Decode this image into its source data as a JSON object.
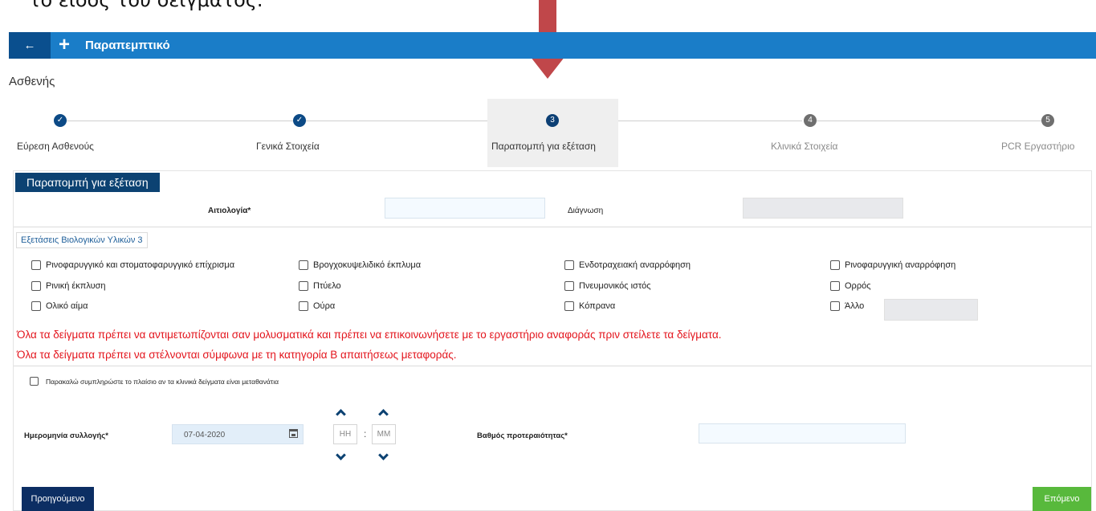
{
  "caption": "το είδος του δείγματος.",
  "header": {
    "back_label": "←",
    "title": "Παραπεμπτικό"
  },
  "page_title": "Ασθενής",
  "steps": [
    {
      "number": "✓",
      "label": "Εύρεση Ασθενούς",
      "state": "done"
    },
    {
      "number": "✓",
      "label": "Γενικά Στοιχεία",
      "state": "done"
    },
    {
      "number": "3",
      "label": "Παραπομπή για εξέταση",
      "state": "current"
    },
    {
      "number": "4",
      "label": "Κλινικά Στοιχεία",
      "state": "todo"
    },
    {
      "number": "5",
      "label": "PCR Εργαστήριο",
      "state": "todo"
    }
  ],
  "form": {
    "section_title": "Παραπομπή για εξέταση",
    "reason_label": "Αιτιολογία*",
    "reason_value": "",
    "diagnosis_label": "Διάγνωση",
    "diagnosis_value": "",
    "samples_tab": "Εξετάσεις Βιολογικών Υλικών 3",
    "samples": [
      "Ρινοφαρυγγικό και στοματοφαρυγγικό επίχρισμα",
      "Βρογχοκυψελιδικό έκπλυμα",
      "Ενδοτραχειακή αναρρόφηση",
      "Ρινοφαρυγγική αναρρόφηση",
      "Ρινική έκπλυση",
      "Πτύελο",
      "Πνευμονικός ιστός",
      "Ορρός",
      "Ολικό αίμα",
      "Ούρα",
      "Κόπρανα",
      "Άλλο"
    ],
    "other_value": "",
    "warning_1": "Όλα τα δείγματα πρέπει να αντιμετωπίζονται σαν μολυσματικά και πρέπει να επικοινωνήσετε με το εργαστήριο αναφοράς πριν στείλετε τα δείγματα.",
    "warning_2": "Όλα τα δείγματα πρέπει να στέλνονται σύμφωνα με τη κατηγορία Β απαιτήσεως μεταφοράς.",
    "transient_label": "Παρακαλώ συμπληρώστε το πλαίσιο αν τα κλινικά δείγματα είναι μεταθανάτια",
    "collection_date_label": "Ημερομηνία συλλογής*",
    "collection_date_value": "07-04-2020",
    "hour_placeholder": "HH",
    "minute_placeholder": "MM",
    "time_separator": ":",
    "priority_label": "Βαθμός προτεραιότητας*",
    "priority_value": ""
  },
  "nav": {
    "prev_label": "Προηγούμενο",
    "next_label": "Επόμενο"
  },
  "colors": {
    "topbar": "#1a7dc8",
    "arrow": "#c0474a",
    "warning": "#e3141c",
    "next": "#58b93c",
    "prev": "#0c2e63"
  }
}
